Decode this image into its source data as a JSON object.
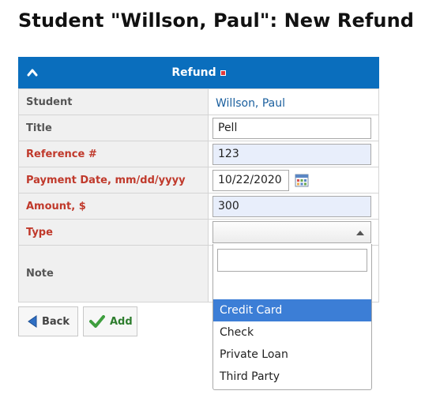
{
  "page": {
    "title": "Student \"Willson, Paul\": New Refund"
  },
  "panel": {
    "title": "Refund"
  },
  "form": {
    "student": {
      "label": "Student",
      "value": "Willson, Paul"
    },
    "title": {
      "label": "Title",
      "value": "Pell"
    },
    "reference": {
      "label": "Reference #",
      "value": "123"
    },
    "payment_date": {
      "label": "Payment Date, mm/dd/yyyy",
      "value": "10/22/2020"
    },
    "amount": {
      "label": "Amount, $",
      "value": "300"
    },
    "type": {
      "label": "Type",
      "value": ""
    },
    "note": {
      "label": "Note",
      "value": ""
    }
  },
  "dropdown": {
    "search_value": "",
    "options": [
      "Credit Card",
      "Check",
      "Private Loan",
      "Third Party"
    ],
    "highlighted": "Credit Card"
  },
  "buttons": {
    "back": "Back",
    "add": "Add"
  },
  "colors": {
    "header_bg": "#0a6ebd",
    "required_label": "#c0392b",
    "link": "#1a5f9e",
    "required_input_bg": "#e8eefb",
    "highlight": "#3c7ed6",
    "add_green": "#2e7d2e"
  },
  "icons": {
    "collapse": "chevron-up-icon",
    "calendar": "calendar-icon",
    "select_arrow": "triangle-up-icon",
    "back": "arrow-left-icon",
    "add": "checkmark-icon"
  }
}
